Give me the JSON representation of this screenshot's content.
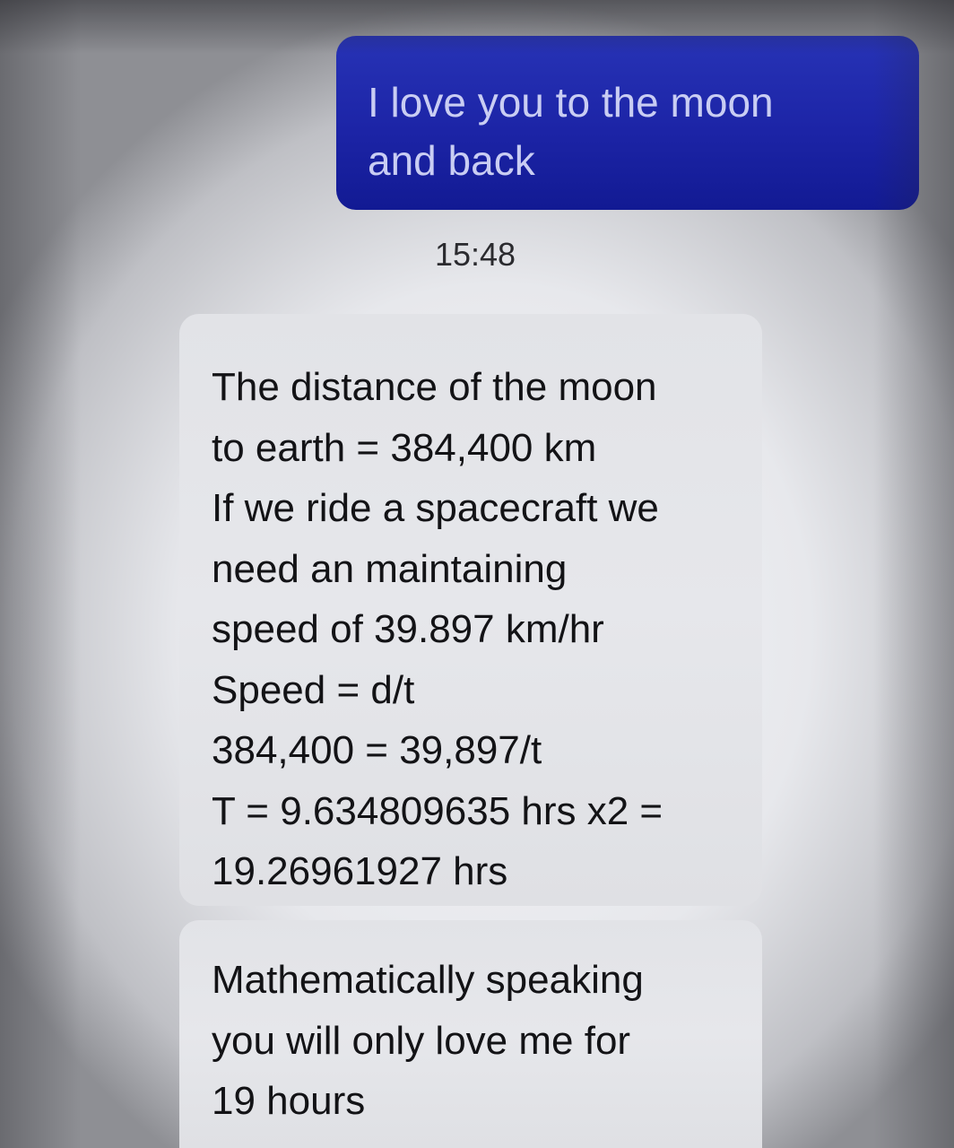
{
  "conversation": {
    "outgoing": {
      "lines": [
        "I love you to the moon",
        "and back"
      ]
    },
    "timestamp": "15:48",
    "incoming": [
      {
        "lines": [
          "The distance of the moon",
          "to earth = 384,400 km",
          "If we ride a spacecraft we",
          "need an maintaining",
          "speed of 39.897 km/hr",
          "Speed = d/t",
          "384,400 = 39,897/t",
          "T = 9.634809635 hrs x2 =",
          "19.26961927 hrs"
        ]
      },
      {
        "lines": [
          "Mathematically speaking",
          "you will only love me for",
          "19 hours"
        ]
      }
    ]
  },
  "colors": {
    "outgoing_bubble": "#1c24a6",
    "outgoing_text": "#c9cdf3",
    "incoming_bubble": "#e4e5e9",
    "incoming_text": "#131316"
  }
}
